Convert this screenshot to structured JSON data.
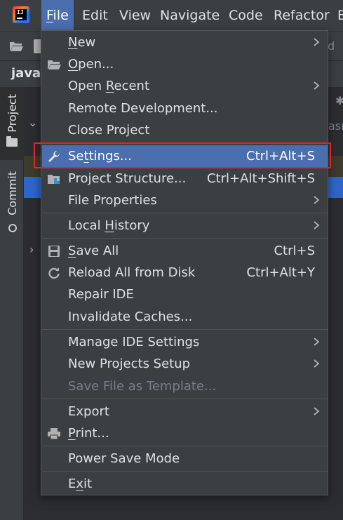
{
  "menubar": {
    "items": [
      {
        "label": "File",
        "mnemonic": "F",
        "active": true
      },
      {
        "label": "Edit",
        "mnemonic": "E"
      },
      {
        "label": "View",
        "mnemonic": "V"
      },
      {
        "label": "Navigate",
        "mnemonic": "N"
      },
      {
        "label": "Code",
        "mnemonic": "C"
      },
      {
        "label": "Refactor",
        "mnemonic": "R"
      },
      {
        "label": "B",
        "mnemonic": "B"
      }
    ]
  },
  "project": {
    "name_fragment": "java-"
  },
  "side_tabs": {
    "project_label": "Project",
    "commit_label": "Commit"
  },
  "background": {
    "right_fragment": "asro",
    "toolbar_fragment": "d"
  },
  "file_menu": {
    "items": [
      {
        "label": "New",
        "submenu": true
      },
      {
        "label": "Open...",
        "icon": "folder-open-icon"
      },
      {
        "label": "Open Recent",
        "submenu": true
      },
      {
        "label": "Remote Development..."
      },
      {
        "label": "Close Project"
      },
      {
        "label": "Settings...",
        "icon": "wrench-icon",
        "shortcut": "Ctrl+Alt+S",
        "selected": true
      },
      {
        "label": "Project Structure...",
        "icon": "project-structure-icon",
        "shortcut": "Ctrl+Alt+Shift+S"
      },
      {
        "label": "File Properties",
        "submenu": true
      },
      {
        "label": "Local History",
        "submenu": true
      },
      {
        "label": "Save All",
        "icon": "save-icon",
        "shortcut": "Ctrl+S"
      },
      {
        "label": "Reload All from Disk",
        "icon": "reload-icon",
        "shortcut": "Ctrl+Alt+Y"
      },
      {
        "label": "Repair IDE"
      },
      {
        "label": "Invalidate Caches..."
      },
      {
        "label": "Manage IDE Settings",
        "submenu": true
      },
      {
        "label": "New Projects Setup",
        "submenu": true
      },
      {
        "label": "Save File as Template...",
        "disabled": true
      },
      {
        "label": "Export",
        "submenu": true
      },
      {
        "label": "Print...",
        "icon": "printer-icon"
      },
      {
        "label": "Power Save Mode"
      },
      {
        "label": "Exit"
      }
    ]
  },
  "colors": {
    "menu_bg": "#3c3f41",
    "selection": "#4b6eaf",
    "highlight_box": "#e0262c",
    "disabled_text": "#7a7e85"
  }
}
